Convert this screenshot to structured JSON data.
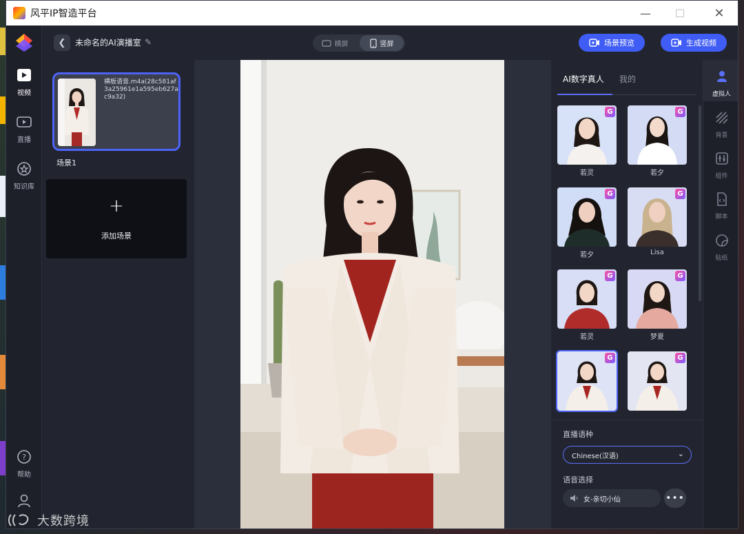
{
  "window": {
    "title": "风平IP智造平台"
  },
  "left_nav": {
    "items": [
      {
        "label": "视频"
      },
      {
        "label": "直播"
      },
      {
        "label": "知识库"
      },
      {
        "label": "帮助"
      }
    ]
  },
  "header": {
    "project_title": "未命名的AI演播室",
    "orientation": {
      "landscape": "横屏",
      "portrait": "竖屏",
      "selected": "竖屏"
    },
    "preview_button": "场景预览",
    "generate_button": "生成视频"
  },
  "scenes": {
    "items": [
      {
        "audio_text": "横板语音.m4a(28c581af3a25961e1a595eb627ac9a32)",
        "label": "场景1"
      }
    ],
    "add_label": "添加场景"
  },
  "avatars_panel": {
    "tabs": [
      {
        "label": "AI数字真人"
      },
      {
        "label": "我的"
      }
    ],
    "badge": "G",
    "items": [
      {
        "name": "若灵"
      },
      {
        "name": "若夕"
      },
      {
        "name": "若夕"
      },
      {
        "name": "Lisa"
      },
      {
        "name": "若灵"
      },
      {
        "name": "梦夏"
      },
      {
        "name": "",
        "selected": true
      },
      {
        "name": ""
      }
    ]
  },
  "settings": {
    "lang_label": "直播语种",
    "lang_value": "Chinese(汉语)",
    "voice_label": "语音选择",
    "voice_value": "女-亲切小仙",
    "more_label": "•••"
  },
  "right_tools": [
    {
      "label": "虚拟人"
    },
    {
      "label": "背景"
    },
    {
      "label": "组件"
    },
    {
      "label": "脚本"
    },
    {
      "label": "贴纸"
    }
  ],
  "watermark": "大数跨境",
  "colors": {
    "accent": "#3f5cf5",
    "panel": "#22252f"
  }
}
